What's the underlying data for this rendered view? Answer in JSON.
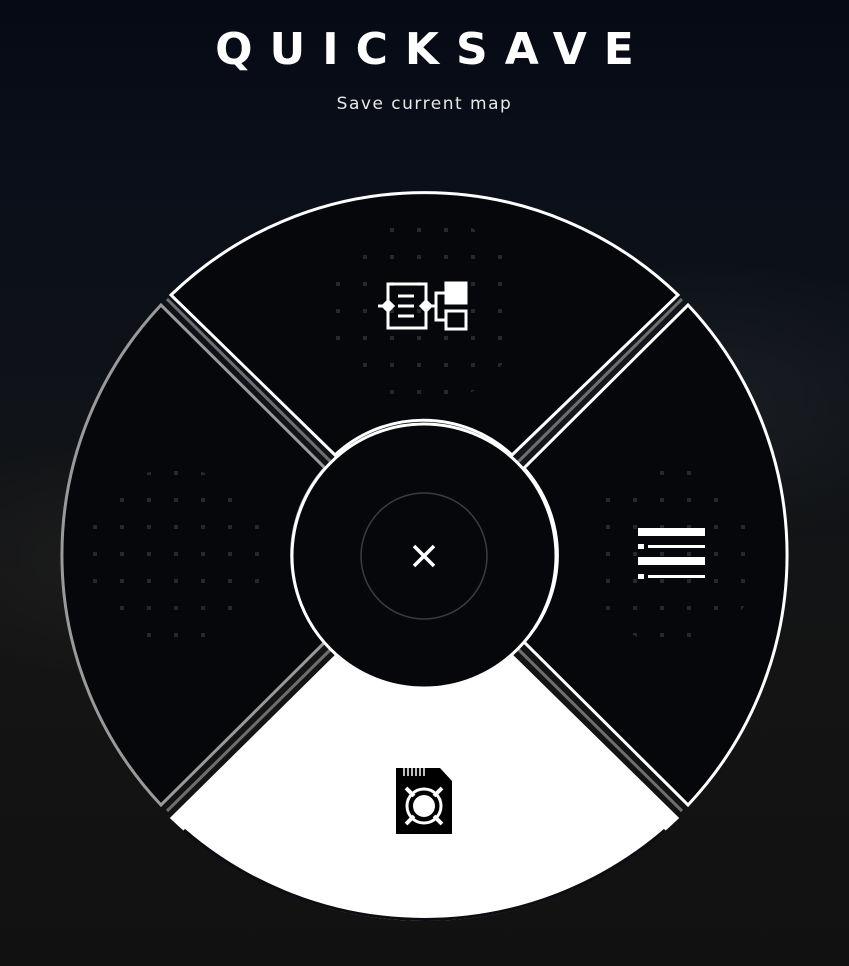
{
  "header": {
    "title": "QUICKSAVE",
    "subtitle": "Save current map"
  },
  "wheel": {
    "segments": [
      {
        "id": "top",
        "icon": "workflow-icon",
        "selected": false
      },
      {
        "id": "right",
        "icon": "list-icon",
        "selected": false
      },
      {
        "id": "bottom",
        "icon": "save-card-icon",
        "selected": true
      },
      {
        "id": "left",
        "icon": "",
        "selected": false
      }
    ],
    "center_icon": "close-icon"
  },
  "colors": {
    "accent": "#ffffff",
    "segment_fill": "#05070b",
    "selected_fill": "#ffffff"
  }
}
